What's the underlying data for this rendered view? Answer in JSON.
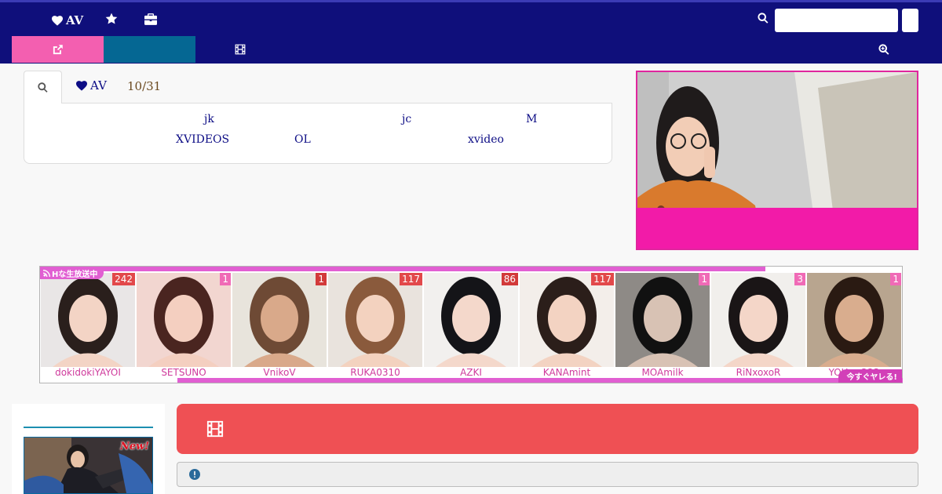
{
  "nav": {
    "av_label": "AV",
    "search_placeholder": ""
  },
  "search_panel": {
    "av_tab_label": "AV",
    "date": "10/31",
    "keywords_row1": [
      "jk",
      "jc",
      "M"
    ],
    "keywords_row2": [
      "XVIDEOS",
      "OL",
      "xvideo"
    ]
  },
  "live_strip": {
    "badge_label": "Hな生放送中",
    "cta_label": "今すぐヤレる!",
    "performers": [
      {
        "name": "dokidokiYAYOI",
        "count": "242"
      },
      {
        "name": "SETSUNO",
        "count": "1"
      },
      {
        "name": "VnikoV",
        "count": "1"
      },
      {
        "name": "RUKA0310",
        "count": "117"
      },
      {
        "name": "AZKI",
        "count": "86"
      },
      {
        "name": "KANAmint",
        "count": "117"
      },
      {
        "name": "MOAmilk",
        "count": "1"
      },
      {
        "name": "RiNxoxoR",
        "count": "3"
      },
      {
        "name": "YOUppQ23",
        "count": "1"
      }
    ]
  },
  "sidebar": {
    "ad_badge": "New!"
  },
  "colors": {
    "navbar": "#0f0f7b",
    "accent_pink": "#f35fb0",
    "accent_teal": "#056793",
    "banner_red": "#ef5054",
    "live_magenta": "#e15fd2"
  },
  "icons": {
    "nav": [
      "heart-icon",
      "star-icon",
      "briefcase-icon",
      "search-icon"
    ],
    "subtabs": [
      "share-icon",
      "film-icon",
      "zoom-in-icon"
    ],
    "banner": "film-icon",
    "notice": "exclamation-circle-icon"
  }
}
